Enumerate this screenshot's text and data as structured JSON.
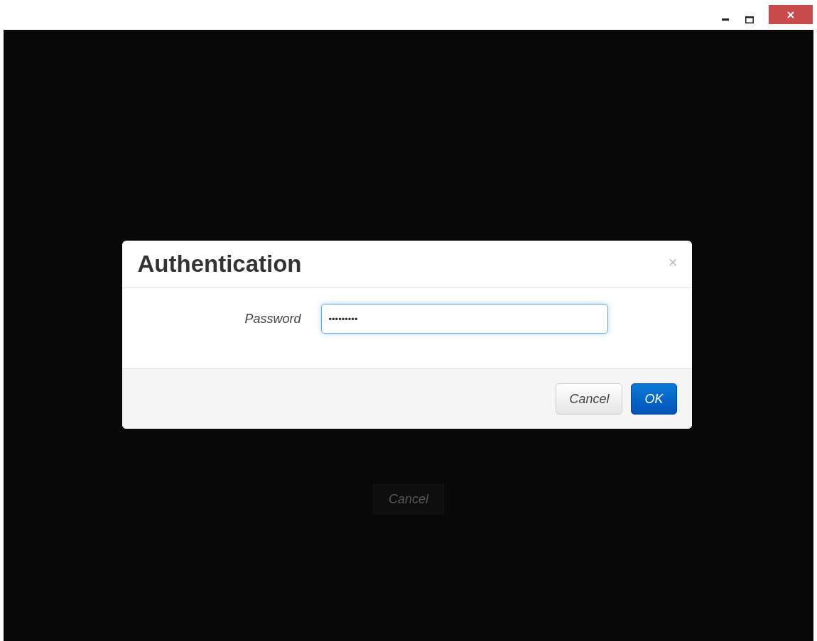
{
  "window": {
    "controls": [
      {
        "kind": "minimize"
      },
      {
        "kind": "maximize"
      },
      {
        "kind": "close"
      }
    ]
  },
  "background_button": {
    "label": "Cancel"
  },
  "dialog": {
    "title": "Authentication",
    "close_glyph": "×",
    "field": {
      "label": "Password",
      "value": "•••••••••"
    },
    "buttons": [
      {
        "label": "Cancel",
        "kind": "default"
      },
      {
        "label": "OK",
        "kind": "primary"
      }
    ]
  }
}
